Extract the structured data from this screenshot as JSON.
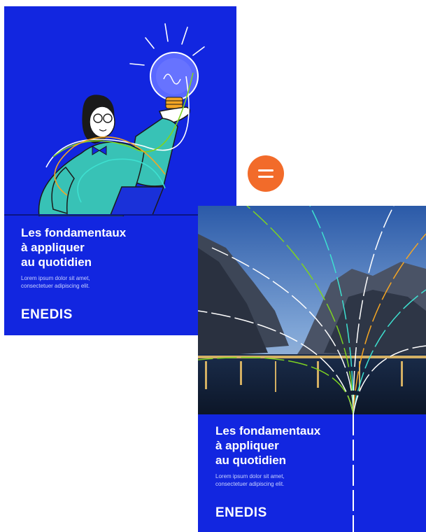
{
  "cards": [
    {
      "title_lines": [
        "Les fondamentaux",
        "à appliquer",
        "au quotidien"
      ],
      "body_lines": [
        "Lorem ipsum dolor sit amet,",
        "consectetuer adipiscing elit."
      ],
      "logo": "ENEDIS",
      "illustration": "person-holding-lightbulb"
    },
    {
      "title_lines": [
        "Les fondamentaux",
        "à appliquer",
        "au quotidien"
      ],
      "body_lines": [
        "Lorem ipsum dolor sit amet,",
        "consectetuer adipiscing elit."
      ],
      "logo": "ENEDIS",
      "illustration": "mountain-lake-photo-with-light-lines"
    }
  ],
  "equals_icon": "equals-icon",
  "colors": {
    "card_background": "#1226e0",
    "equals_button": "#f26b2a",
    "logo_accent": "#7ed321"
  }
}
